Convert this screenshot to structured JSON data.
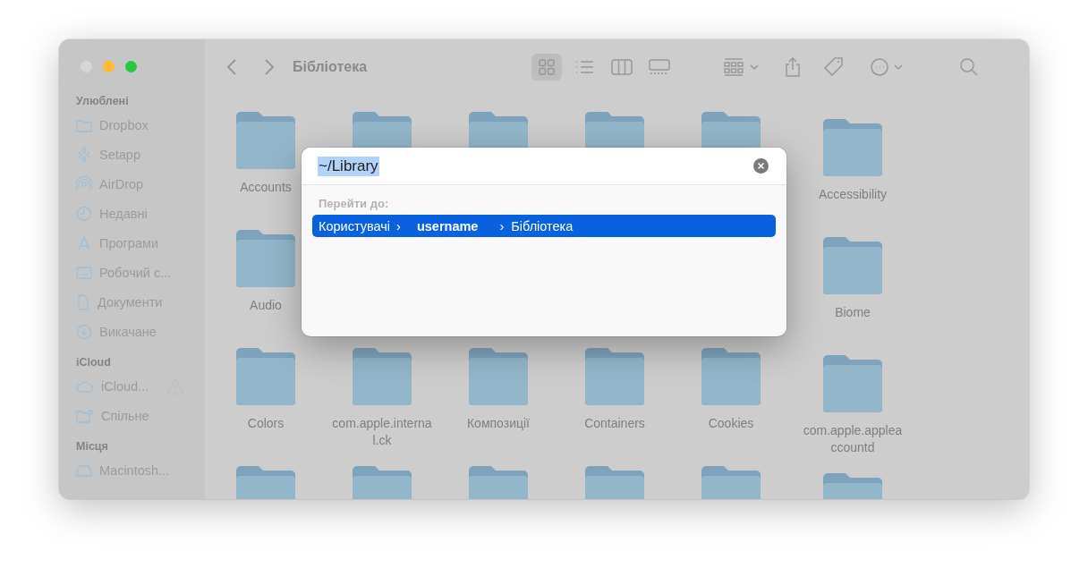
{
  "window": {
    "title": "Бібліотека",
    "dimmed": true
  },
  "toolbar": {
    "view_buttons": [
      {
        "selected": true
      },
      {
        "selected": false
      },
      {
        "selected": false
      },
      {
        "selected": false
      }
    ]
  },
  "sidebar": {
    "sections": [
      {
        "title": "Улюблені",
        "items": [
          {
            "label": "Dropbox"
          },
          {
            "label": "Setapp"
          },
          {
            "label": "AirDrop"
          },
          {
            "label": "Недавні"
          },
          {
            "label": "Програми"
          },
          {
            "label": "Робочий с..."
          },
          {
            "label": "Документи"
          },
          {
            "label": "Викачане"
          }
        ]
      },
      {
        "title": "iCloud",
        "items": [
          {
            "label": "iCloud..."
          },
          {
            "label": "Спільне"
          }
        ]
      },
      {
        "title": "Місця",
        "items": [
          {
            "label": "Macintosh..."
          }
        ]
      }
    ]
  },
  "folders": [
    [
      {
        "kind": "folder",
        "label": "Accounts"
      },
      {
        "kind": "folder"
      },
      {
        "kind": "folder"
      },
      {
        "kind": "folder"
      },
      {
        "kind": "folder"
      },
      {
        "kind": "folder",
        "label": "Accessibility"
      }
    ],
    [
      {
        "kind": "folder",
        "label": "Audio"
      },
      {
        "kind": "folder",
        "label": "Biome"
      }
    ],
    [
      {
        "kind": "folder",
        "label": "Colors"
      },
      {
        "kind": "folder",
        "label": "com.apple.interna l.ck"
      },
      {
        "kind": "folder",
        "label": "Композиції"
      },
      {
        "kind": "folder",
        "label": "Containers"
      },
      {
        "kind": "folder",
        "label": "Cookies"
      },
      {
        "kind": "folder",
        "label": "com.apple.applea ccountd"
      }
    ],
    [
      {
        "kind": "folder"
      },
      {
        "kind": "folder"
      },
      {
        "kind": "folder"
      },
      {
        "kind": "folder"
      },
      {
        "kind": "folder"
      },
      {
        "kind": "folder"
      }
    ]
  ],
  "go_to_dialog": {
    "value": "~/Library",
    "value_selected": true,
    "section_title": "Перейти до:",
    "results": [
      {
        "selected": true,
        "separator": "›",
        "path": [
          {
            "label": "Користувачі",
            "bold": false
          },
          {
            "label": "username",
            "bold": true
          },
          {
            "label": "Бібліотека",
            "bold": false
          }
        ]
      }
    ]
  }
}
